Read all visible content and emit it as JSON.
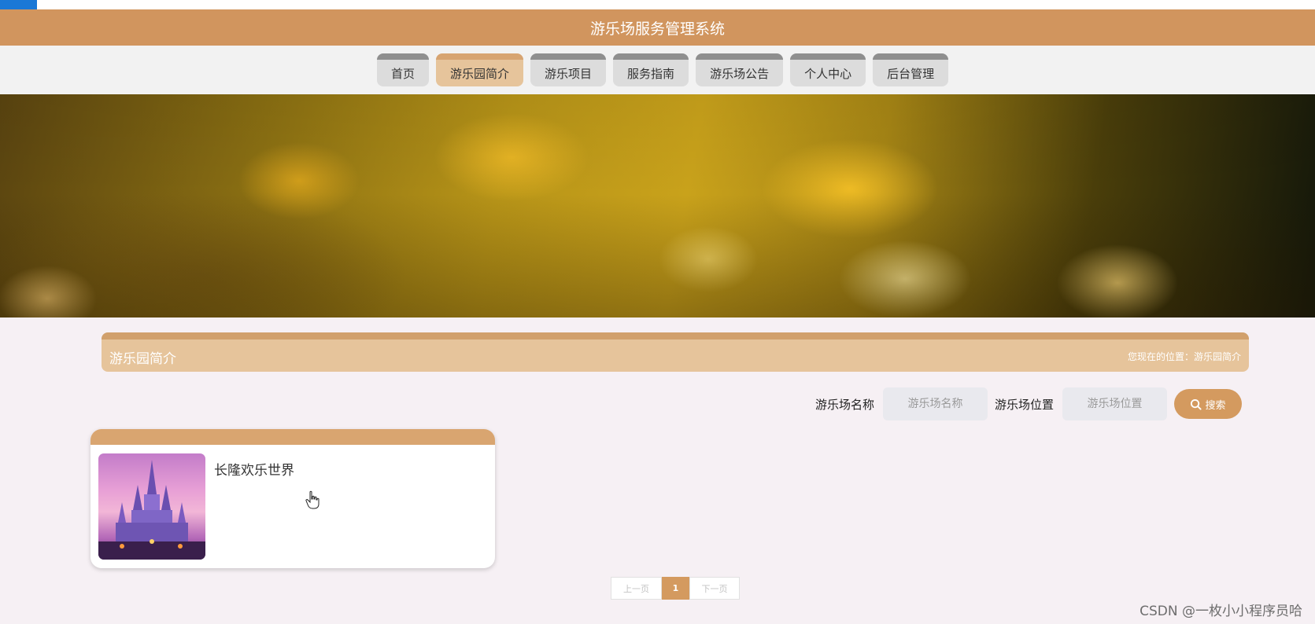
{
  "header": {
    "title": "游乐场服务管理系统"
  },
  "nav": {
    "items": [
      {
        "label": "首页",
        "active": false
      },
      {
        "label": "游乐园简介",
        "active": true
      },
      {
        "label": "游乐项目",
        "active": false
      },
      {
        "label": "服务指南",
        "active": false
      },
      {
        "label": "游乐场公告",
        "active": false
      },
      {
        "label": "个人中心",
        "active": false
      },
      {
        "label": "后台管理",
        "active": false
      }
    ]
  },
  "section": {
    "title": "游乐园简介",
    "breadcrumb": "您现在的位置：游乐园简介"
  },
  "search": {
    "name_label": "游乐场名称",
    "name_placeholder": "游乐场名称",
    "location_label": "游乐场位置",
    "location_placeholder": "游乐场位置",
    "button_label": "搜索",
    "button_icon": "search-icon"
  },
  "list": {
    "items": [
      {
        "title": "长隆欢乐世界",
        "image": "castle-image"
      }
    ]
  },
  "pagination": {
    "prev_label": "上一页",
    "current_page": "1",
    "next_label": "下一页"
  },
  "watermark": "CSDN @一枚小小程序员哈",
  "colors": {
    "accent": "#d1955e",
    "nav_active": "#e6c49b",
    "blue_strip": "#1a78d6"
  }
}
